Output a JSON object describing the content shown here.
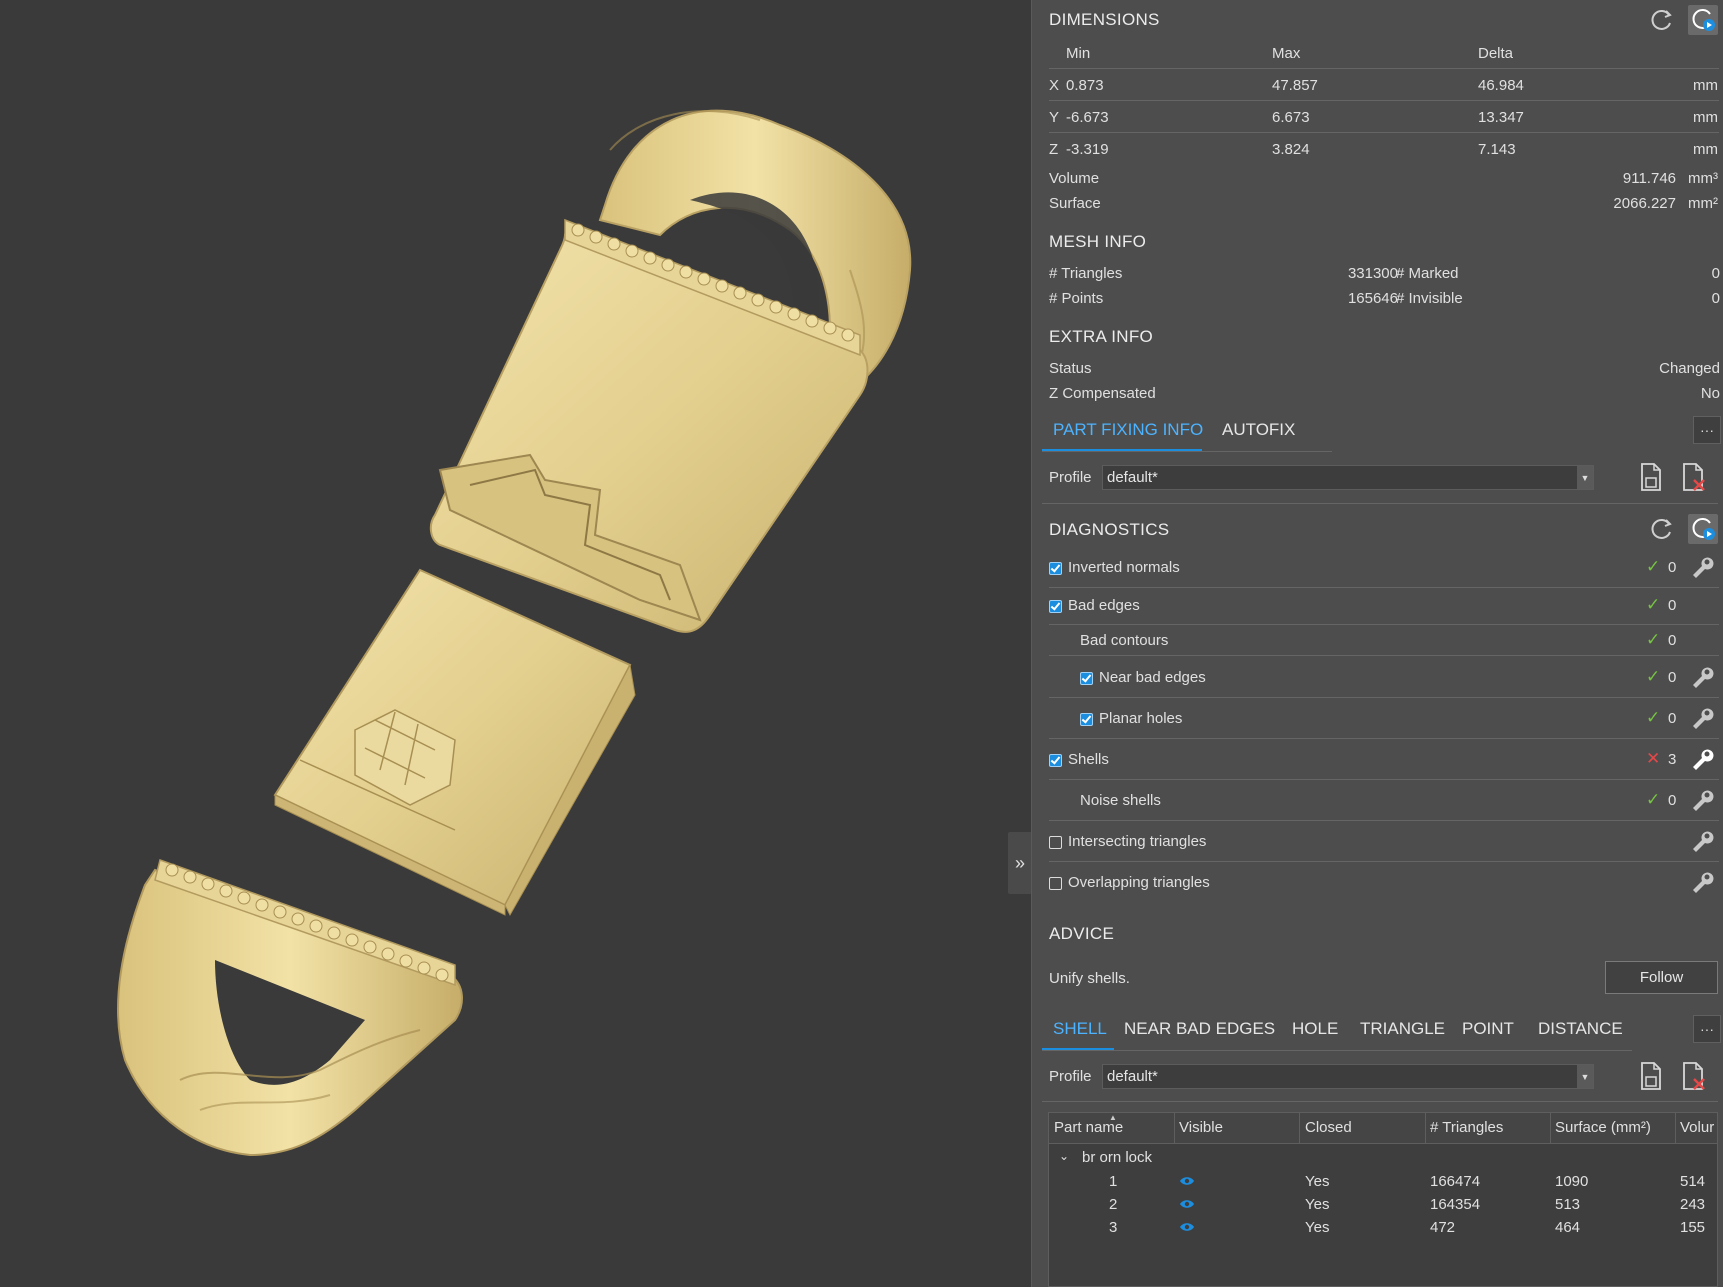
{
  "dimensions": {
    "title": "DIMENSIONS",
    "col_min": "Min",
    "col_max": "Max",
    "col_delta": "Delta",
    "rows": [
      {
        "axis": "X",
        "min": "0.873",
        "max": "47.857",
        "delta": "46.984",
        "unit": "mm"
      },
      {
        "axis": "Y",
        "min": "-6.673",
        "max": "6.673",
        "delta": "13.347",
        "unit": "mm"
      },
      {
        "axis": "Z",
        "min": "-3.319",
        "max": "3.824",
        "delta": "7.143",
        "unit": "mm"
      }
    ],
    "volume_label": "Volume",
    "volume_value": "911.746",
    "volume_unit": "mm³",
    "surface_label": "Surface",
    "surface_value": "2066.227",
    "surface_unit": "mm²"
  },
  "mesh_info": {
    "title": "MESH INFO",
    "triangles_label": "# Triangles",
    "triangles_value": "331300",
    "points_label": "# Points",
    "points_value": "165646",
    "marked_label": "# Marked",
    "marked_value": "0",
    "invisible_label": "# Invisible",
    "invisible_value": "0"
  },
  "extra_info": {
    "title": "EXTRA INFO",
    "status_label": "Status",
    "status_value": "Changed",
    "zcomp_label": "Z Compensated",
    "zcomp_value": "No"
  },
  "tabs_top": {
    "part_fixing": "PART FIXING INFO",
    "autofix": "AUTOFIX",
    "more": "···"
  },
  "profile_top": {
    "label": "Profile",
    "value": "default*"
  },
  "diagnostics": {
    "title": "DIAGNOSTICS",
    "items": [
      {
        "label": "Inverted normals",
        "count": "0",
        "status": "ok",
        "checked": true
      },
      {
        "label": "Bad edges",
        "count": "0",
        "status": "ok",
        "checked": true
      },
      {
        "label": "Bad contours",
        "count": "0",
        "status": "ok"
      },
      {
        "label": "Near bad edges",
        "count": "0",
        "status": "ok",
        "checked": true
      },
      {
        "label": "Planar holes",
        "count": "0",
        "status": "ok",
        "checked": true
      },
      {
        "label": "Shells",
        "count": "3",
        "status": "error",
        "checked": true
      },
      {
        "label": "Noise shells",
        "count": "0",
        "status": "ok"
      },
      {
        "label": "Intersecting triangles",
        "checked": false
      },
      {
        "label": "Overlapping triangles",
        "checked": false
      }
    ]
  },
  "advice": {
    "title": "ADVICE",
    "text": "Unify shells.",
    "follow": "Follow"
  },
  "tabs_bottom": {
    "shell": "SHELL",
    "near_bad_edges": "NEAR BAD EDGES",
    "hole": "HOLE",
    "triangle": "TRIANGLE",
    "point": "POINT",
    "distance": "DISTANCE",
    "more": "···"
  },
  "profile_bottom": {
    "label": "Profile",
    "value": "default*"
  },
  "table": {
    "headers": [
      "Part name",
      "Visible",
      "Closed",
      "# Triangles",
      "Surface (mm²)",
      "Volur"
    ],
    "group": "br orn lock",
    "rows": [
      {
        "name": "1",
        "closed": "Yes",
        "triangles": "166474",
        "surface": "1090",
        "volume": "514"
      },
      {
        "name": "2",
        "closed": "Yes",
        "triangles": "164354",
        "surface": "513",
        "volume": "243"
      },
      {
        "name": "3",
        "closed": "Yes",
        "triangles": "472",
        "surface": "464",
        "volume": "155"
      }
    ]
  },
  "viewport": {
    "collapse_glyph": "»"
  },
  "colors": {
    "accent": "#1c8ee0",
    "ok": "#76c442",
    "error": "#e44848",
    "model": "#e8d79a"
  }
}
